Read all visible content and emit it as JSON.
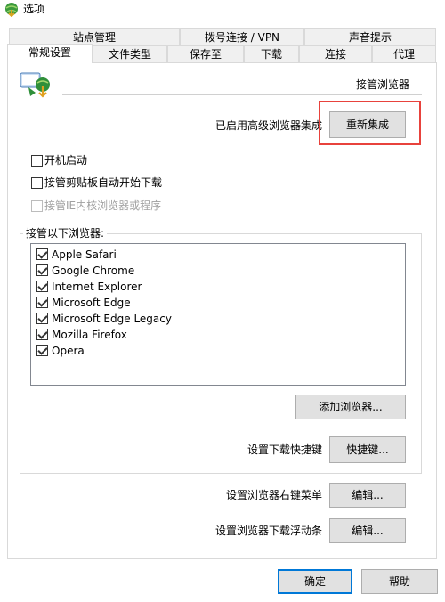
{
  "window": {
    "title": "选项",
    "icon": "idm-globe-icon"
  },
  "tabs_top_row": [
    {
      "label": "站点管理"
    },
    {
      "label": "拨号连接 / VPN"
    },
    {
      "label": "声音提示"
    }
  ],
  "tabs_bottom_row": [
    {
      "label": "常规设置",
      "active": true
    },
    {
      "label": "文件类型"
    },
    {
      "label": "保存至"
    },
    {
      "label": "下载"
    },
    {
      "label": "连接"
    },
    {
      "label": "代理"
    }
  ],
  "general": {
    "browser_integration_label": "接管浏览器",
    "integration_status": "已启用高级浏览器集成",
    "reintegrate_button": "重新集成",
    "startup_checkbox": {
      "label": "开机启动",
      "checked": false
    },
    "clipboard_checkbox": {
      "label": "接管剪贴板自动开始下载",
      "checked": false
    },
    "ie_checkbox": {
      "label": "接管IE内核浏览器或程序",
      "checked": false,
      "disabled": true
    },
    "browsers_group_label": "接管以下浏览器:",
    "browsers": [
      {
        "name": "Apple Safari",
        "checked": true
      },
      {
        "name": "Google Chrome",
        "checked": true
      },
      {
        "name": "Internet Explorer",
        "checked": true
      },
      {
        "name": "Microsoft Edge",
        "checked": true
      },
      {
        "name": "Microsoft Edge Legacy",
        "checked": true
      },
      {
        "name": "Mozilla Firefox",
        "checked": true
      },
      {
        "name": "Opera",
        "checked": true
      }
    ],
    "add_browser_button": "添加浏览器...",
    "shortcut_label": "设置下载快捷键",
    "shortcut_button": "快捷键...",
    "context_menu_label": "设置浏览器右键菜单",
    "context_menu_button": "编辑...",
    "float_bar_label": "设置浏览器下载浮动条",
    "float_bar_button": "编辑..."
  },
  "footer": {
    "ok_button": "确定",
    "help_button": "帮助"
  },
  "colors": {
    "highlight_box": "#e8423c",
    "primary_button_border": "#0078d7",
    "tab_background": "#f0f0f0"
  }
}
